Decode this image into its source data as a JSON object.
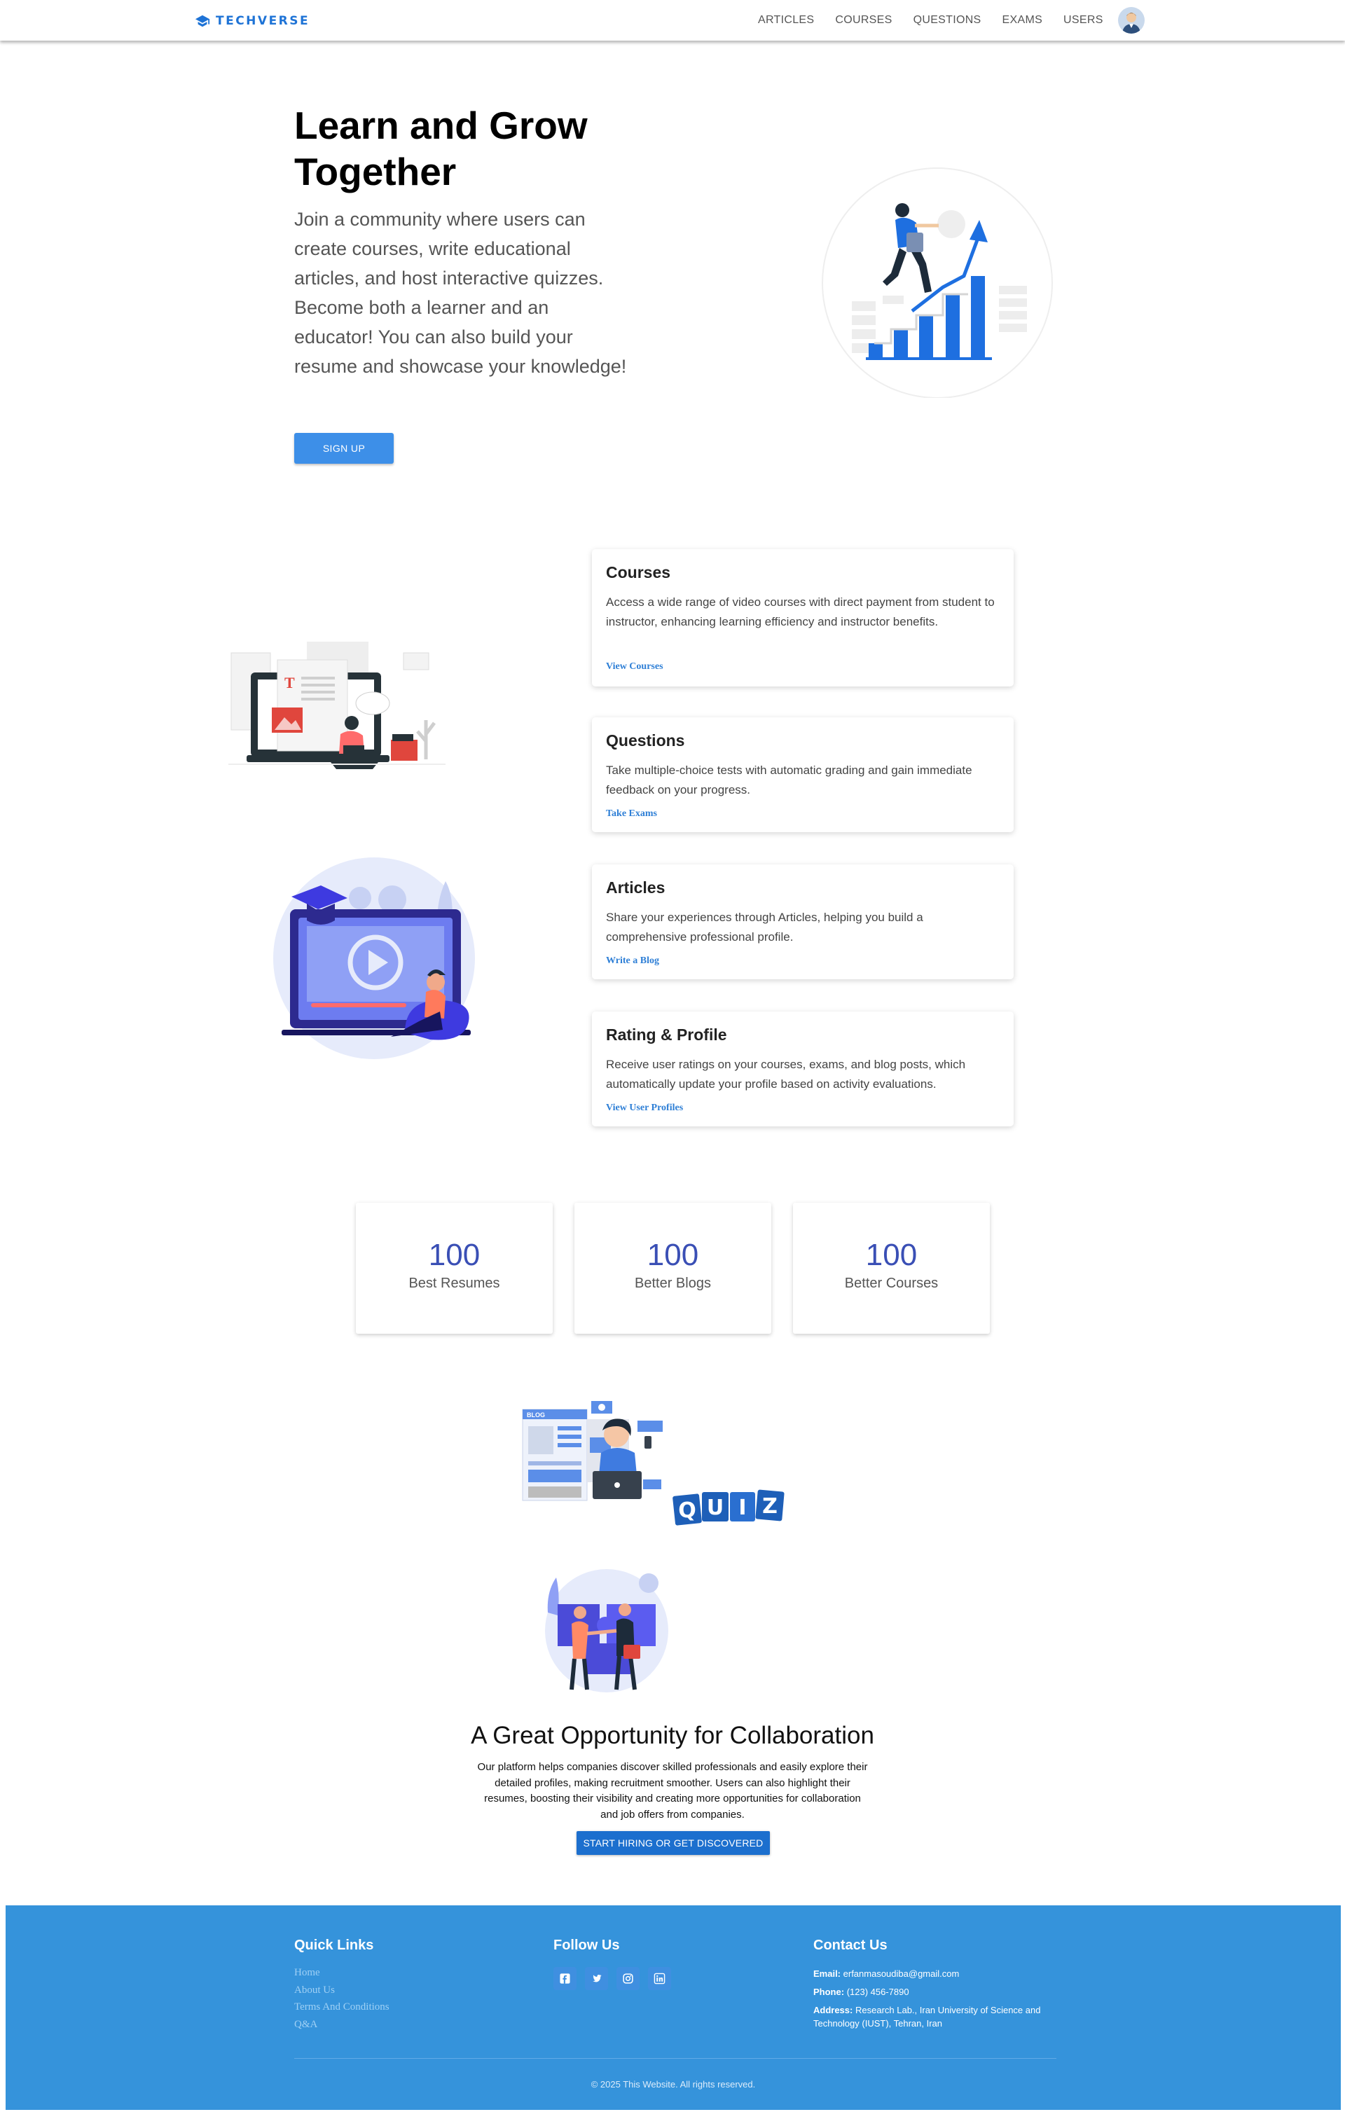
{
  "brand": {
    "name": "TECHVERSE",
    "icon": "graduation-cap-icon",
    "color": "#1e73d6"
  },
  "nav": {
    "items": [
      {
        "label": "ARTICLES"
      },
      {
        "label": "COURSES"
      },
      {
        "label": "QUESTIONS"
      },
      {
        "label": "EXAMS"
      },
      {
        "label": "USERS"
      }
    ],
    "avatar_icon": "user-avatar-icon"
  },
  "hero": {
    "title": "Learn and Grow Together",
    "text": "Join a community where users can create courses, write educational articles, and host interactive quizzes. Become both a learner and an educator! You can also build your resume and showcase your knowledge!",
    "signup_label": "SIGN UP",
    "illustration_icon": "growth-chart-illustration"
  },
  "features": [
    {
      "title": "Courses",
      "description": "Access a wide range of video courses with direct payment from student to instructor, enhancing learning efficiency and instructor benefits.",
      "link": "View Courses"
    },
    {
      "title": "Questions",
      "description": "Take multiple-choice tests with automatic grading and gain immediate feedback on your progress.",
      "link": "Take Exams"
    },
    {
      "title": "Articles",
      "description": "Share your experiences through Articles, helping you build a comprehensive professional profile.",
      "link": "Write a Blog"
    },
    {
      "title": "Rating & Profile",
      "description": "Receive user ratings on your courses, exams, and blog posts, which automatically update your profile based on activity evaluations.",
      "link": "View User Profiles"
    }
  ],
  "stats": [
    {
      "value": "100",
      "label": "Best Resumes"
    },
    {
      "value": "100",
      "label": "Better Blogs"
    },
    {
      "value": "100",
      "label": "Better Courses"
    }
  ],
  "collab": {
    "quiz_word": "QUIZ",
    "blog_tag": "BLOG",
    "title": "A Great Opportunity for Collaboration",
    "text": "Our platform helps companies discover skilled professionals and easily explore their detailed profiles, making recruitment smoother. Users can also highlight their resumes, boosting their visibility and creating more opportunities for collaboration and job offers from companies.",
    "button_label": "START HIRING OR GET DISCOVERED"
  },
  "footer": {
    "quick_links_title": "Quick Links",
    "quick_links": [
      "Home",
      "About Us",
      "Terms And Conditions",
      "Q&A"
    ],
    "follow_title": "Follow Us",
    "social": [
      "facebook-icon",
      "twitter-icon",
      "instagram-icon",
      "linkedin-icon"
    ],
    "contact_title": "Contact Us",
    "email_label": "Email:",
    "email": "erfanmasoudiba@gmail.com",
    "phone_label": "Phone:",
    "phone": "(123) 456-7890",
    "address_label": "Address:",
    "address": "Research Lab., Iran University of Science and Technology (IUST), Tehran, Iran",
    "copyright": "© 2025 This Website. All rights reserved."
  },
  "colors": {
    "primary": "#3d8fe8",
    "footer_bg": "#3593db",
    "stat_number": "#3a4fb5",
    "link": "#2e7fd6"
  }
}
